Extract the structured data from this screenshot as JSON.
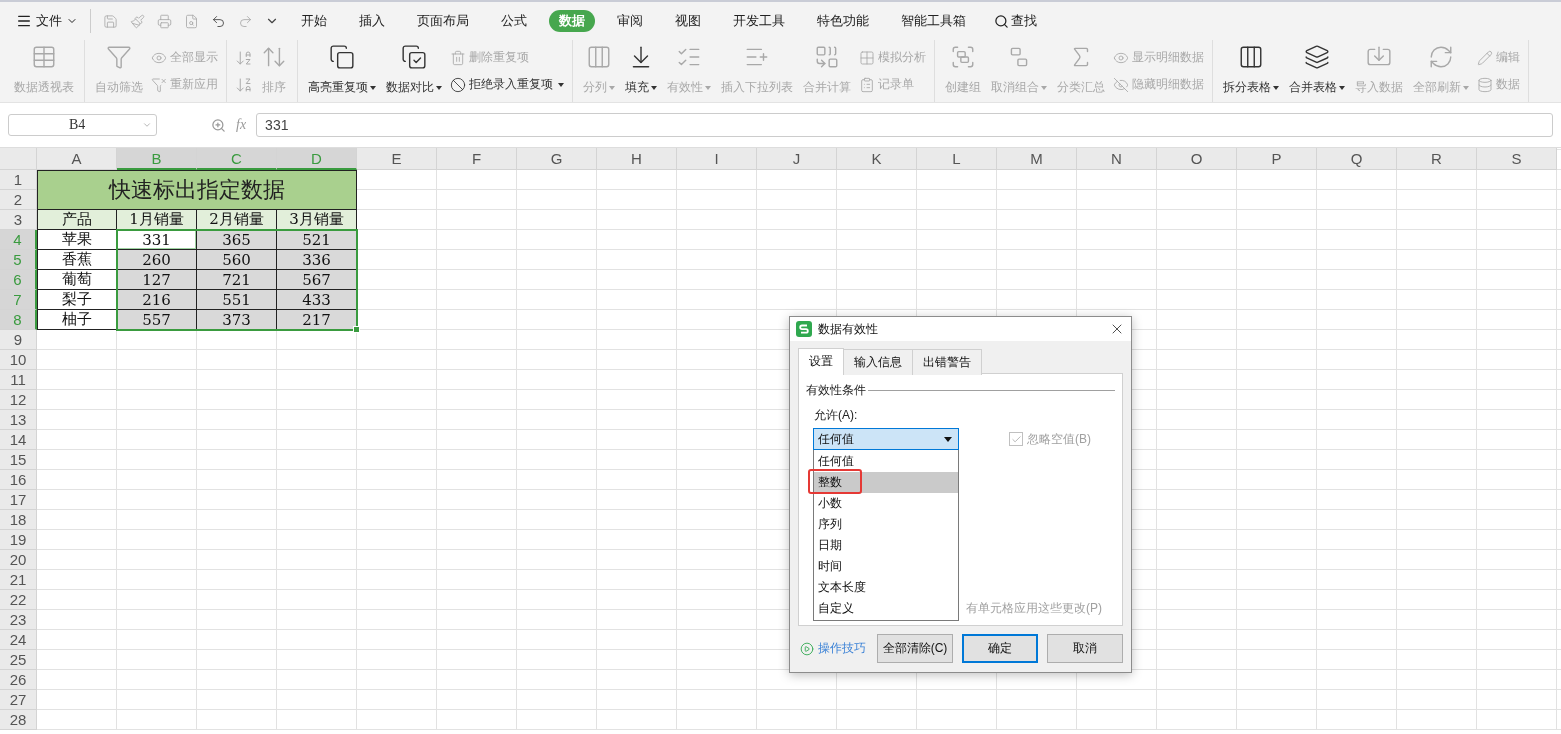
{
  "menu": {
    "label": "文件"
  },
  "tabs": [
    {
      "label": "开始",
      "selected": false
    },
    {
      "label": "插入",
      "selected": false
    },
    {
      "label": "页面布局",
      "selected": false
    },
    {
      "label": "公式",
      "selected": false
    },
    {
      "label": "数据",
      "selected": true
    },
    {
      "label": "审阅",
      "selected": false
    },
    {
      "label": "视图",
      "selected": false
    },
    {
      "label": "开发工具",
      "selected": false
    },
    {
      "label": "特色功能",
      "selected": false
    },
    {
      "label": "智能工具箱",
      "selected": false
    }
  ],
  "search": {
    "label": "查找"
  },
  "ribbon": {
    "groups": [
      {
        "columns": [
          {
            "kind": "large",
            "label": "数据透视表",
            "disabled": true,
            "dropdown": false
          }
        ]
      },
      {
        "columns": [
          {
            "kind": "large",
            "label": "自动筛选",
            "disabled": true,
            "dropdown": false
          },
          {
            "kind": "stack",
            "items": [
              {
                "kind": "small",
                "label": "全部显示",
                "disabled": true,
                "dropdown": false
              },
              {
                "kind": "small",
                "label": "重新应用",
                "disabled": true,
                "dropdown": false
              }
            ]
          }
        ]
      },
      {
        "columns": [
          {
            "kind": "stack",
            "items": [
              {
                "kind": "icon",
                "disabled": true
              },
              {
                "kind": "icon",
                "disabled": true
              }
            ]
          },
          {
            "kind": "large",
            "label": "排序",
            "disabled": true,
            "dropdown": false
          }
        ]
      },
      {
        "columns": [
          {
            "kind": "large",
            "label": "高亮重复项",
            "disabled": false,
            "dropdown": true
          },
          {
            "kind": "large",
            "label": "数据对比",
            "disabled": false,
            "dropdown": true
          },
          {
            "kind": "stack",
            "items": [
              {
                "kind": "small",
                "label": "删除重复项",
                "disabled": true,
                "dropdown": false
              },
              {
                "kind": "small",
                "label": "拒绝录入重复项",
                "disabled": false,
                "dropdown": true
              }
            ]
          }
        ]
      },
      {
        "columns": [
          {
            "kind": "large",
            "label": "分列",
            "disabled": true,
            "dropdown": true
          },
          {
            "kind": "large",
            "label": "填充",
            "disabled": false,
            "dropdown": true
          },
          {
            "kind": "large",
            "label": "有效性",
            "disabled": true,
            "dropdown": true
          },
          {
            "kind": "large",
            "label": "插入下拉列表",
            "disabled": true,
            "dropdown": false
          },
          {
            "kind": "large",
            "label": "合并计算",
            "disabled": true,
            "dropdown": false
          },
          {
            "kind": "stack",
            "items": [
              {
                "kind": "small",
                "label": "模拟分析",
                "disabled": true,
                "dropdown": false
              },
              {
                "kind": "small",
                "label": "记录单",
                "disabled": true,
                "dropdown": false
              }
            ]
          }
        ]
      },
      {
        "columns": [
          {
            "kind": "large",
            "label": "创建组",
            "disabled": true,
            "dropdown": false
          },
          {
            "kind": "large",
            "label": "取消组合",
            "disabled": true,
            "dropdown": true
          },
          {
            "kind": "large",
            "label": "分类汇总",
            "disabled": true,
            "dropdown": false
          },
          {
            "kind": "stack",
            "items": [
              {
                "kind": "small",
                "label": "显示明细数据",
                "disabled": true,
                "dropdown": false
              },
              {
                "kind": "small",
                "label": "隐藏明细数据",
                "disabled": true,
                "dropdown": false
              }
            ]
          }
        ]
      },
      {
        "columns": [
          {
            "kind": "large",
            "label": "拆分表格",
            "disabled": false,
            "dropdown": true
          },
          {
            "kind": "large",
            "label": "合并表格",
            "disabled": false,
            "dropdown": true
          },
          {
            "kind": "large",
            "label": "导入数据",
            "disabled": true,
            "dropdown": false
          },
          {
            "kind": "large",
            "label": "全部刷新",
            "disabled": true,
            "dropdown": true
          },
          {
            "kind": "stack",
            "items": [
              {
                "kind": "small",
                "label": "编辑",
                "disabled": true,
                "dropdown": false
              },
              {
                "kind": "small",
                "label": "数据",
                "disabled": true,
                "dropdown": false
              }
            ]
          }
        ]
      }
    ]
  },
  "formula_bar": {
    "cell_ref": "B4",
    "fx": "fx",
    "value": "331"
  },
  "sheet": {
    "columns": [
      {
        "label": "A",
        "selected": false
      },
      {
        "label": "B",
        "selected": true
      },
      {
        "label": "C",
        "selected": true
      },
      {
        "label": "D",
        "selected": true
      },
      {
        "label": "E",
        "selected": false
      },
      {
        "label": "F",
        "selected": false
      },
      {
        "label": "G",
        "selected": false
      },
      {
        "label": "H",
        "selected": false
      },
      {
        "label": "I",
        "selected": false
      },
      {
        "label": "J",
        "selected": false
      },
      {
        "label": "K",
        "selected": false
      },
      {
        "label": "L",
        "selected": false
      },
      {
        "label": "M",
        "selected": false
      },
      {
        "label": "N",
        "selected": false
      },
      {
        "label": "O",
        "selected": false
      },
      {
        "label": "P",
        "selected": false
      },
      {
        "label": "Q",
        "selected": false
      },
      {
        "label": "R",
        "selected": false
      },
      {
        "label": "S",
        "selected": false
      }
    ],
    "rows": [
      {
        "label": "1",
        "selected": false
      },
      {
        "label": "2",
        "selected": false
      },
      {
        "label": "3",
        "selected": false
      },
      {
        "label": "4",
        "selected": true
      },
      {
        "label": "5",
        "selected": true
      },
      {
        "label": "6",
        "selected": true
      },
      {
        "label": "7",
        "selected": true
      },
      {
        "label": "8",
        "selected": true
      },
      {
        "label": "9",
        "selected": false
      },
      {
        "label": "10",
        "selected": false
      },
      {
        "label": "11",
        "selected": false
      },
      {
        "label": "12",
        "selected": false
      },
      {
        "label": "13",
        "selected": false
      },
      {
        "label": "14",
        "selected": false
      },
      {
        "label": "15",
        "selected": false
      },
      {
        "label": "16",
        "selected": false
      },
      {
        "label": "17",
        "selected": false
      },
      {
        "label": "18",
        "selected": false
      },
      {
        "label": "19",
        "selected": false
      },
      {
        "label": "20",
        "selected": false
      },
      {
        "label": "21",
        "selected": false
      },
      {
        "label": "22",
        "selected": false
      },
      {
        "label": "23",
        "selected": false
      },
      {
        "label": "24",
        "selected": false
      },
      {
        "label": "25",
        "selected": false
      },
      {
        "label": "26",
        "selected": false
      },
      {
        "label": "27",
        "selected": false
      },
      {
        "label": "28",
        "selected": false
      }
    ],
    "table": {
      "title": "快速标出指定数据",
      "headers": [
        "产品",
        "1月销量",
        "2月销量",
        "3月销量"
      ],
      "rows": [
        {
          "cells": [
            {
              "text": "苹果",
              "selected": false,
              "active": false
            },
            {
              "text": "331",
              "selected": true,
              "active": true
            },
            {
              "text": "365",
              "selected": true,
              "active": false
            },
            {
              "text": "521",
              "selected": true,
              "active": false
            }
          ]
        },
        {
          "cells": [
            {
              "text": "香蕉",
              "selected": false,
              "active": false
            },
            {
              "text": "260",
              "selected": true,
              "active": false
            },
            {
              "text": "560",
              "selected": true,
              "active": false
            },
            {
              "text": "336",
              "selected": true,
              "active": false
            }
          ]
        },
        {
          "cells": [
            {
              "text": "葡萄",
              "selected": false,
              "active": false
            },
            {
              "text": "127",
              "selected": true,
              "active": false
            },
            {
              "text": "721",
              "selected": true,
              "active": false
            },
            {
              "text": "567",
              "selected": true,
              "active": false
            }
          ]
        },
        {
          "cells": [
            {
              "text": "梨子",
              "selected": false,
              "active": false
            },
            {
              "text": "216",
              "selected": true,
              "active": false
            },
            {
              "text": "551",
              "selected": true,
              "active": false
            },
            {
              "text": "433",
              "selected": true,
              "active": false
            }
          ]
        },
        {
          "cells": [
            {
              "text": "柚子",
              "selected": false,
              "active": false
            },
            {
              "text": "557",
              "selected": true,
              "active": false
            },
            {
              "text": "373",
              "selected": true,
              "active": false
            },
            {
              "text": "217",
              "selected": true,
              "active": false
            }
          ]
        }
      ]
    }
  },
  "dialog": {
    "title": "数据有效性",
    "tabs": [
      {
        "label": "设置",
        "selected": true
      },
      {
        "label": "输入信息",
        "selected": false
      },
      {
        "label": "出错警告",
        "selected": false
      }
    ],
    "group_label": "有效性条件",
    "allow_label": "允许(A):",
    "allow_value": "任何值",
    "ignore_blank": {
      "label": "忽略空值(B)",
      "checked": true,
      "disabled": true
    },
    "apply_all": {
      "label": "有单元格应用这些更改(P)"
    },
    "options": [
      {
        "label": "任何值",
        "selected": false,
        "highlighted": false
      },
      {
        "label": "整数",
        "selected": true,
        "highlighted": true
      },
      {
        "label": "小数",
        "selected": false,
        "highlighted": false
      },
      {
        "label": "序列",
        "selected": false,
        "highlighted": false
      },
      {
        "label": "日期",
        "selected": false,
        "highlighted": false
      },
      {
        "label": "时间",
        "selected": false,
        "highlighted": false
      },
      {
        "label": "文本长度",
        "selected": false,
        "highlighted": false
      },
      {
        "label": "自定义",
        "selected": false,
        "highlighted": false
      }
    ],
    "tips_link": "操作技巧",
    "buttons": [
      {
        "label": "全部清除(C)",
        "kind": "normal"
      },
      {
        "label": "确定",
        "kind": "default"
      },
      {
        "label": "取消",
        "kind": "normal"
      }
    ]
  }
}
